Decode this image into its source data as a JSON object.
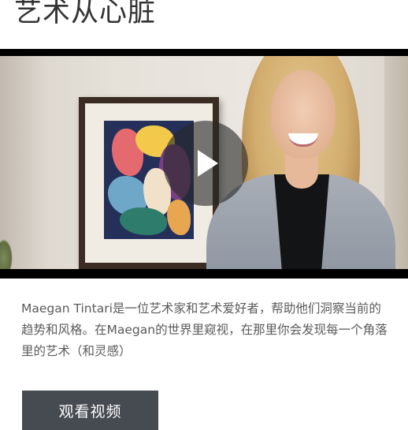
{
  "page": {
    "title": "艺术从心脏"
  },
  "video": {
    "play_icon": "play-icon",
    "overlay_color": "#282828"
  },
  "description": "Maegan Tintari是一位艺术家和艺术爱好者，帮助他们洞察当前的趋势和风格。在Maegan的世界里窥视，在那里你会发现每一个角落里的艺术（和灵感）",
  "cta": {
    "label": "观看视频",
    "background": "#464b52"
  }
}
